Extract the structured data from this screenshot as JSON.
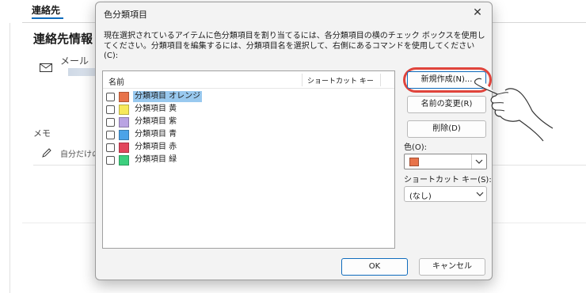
{
  "background": {
    "tab": "連絡先",
    "title": "連絡先情報",
    "mail_label": "メール",
    "memo_label": "メモ",
    "memo_placeholder": "自分だけの"
  },
  "dialog": {
    "title": "色分類項目",
    "description": "現在選択されているアイテムに色分類項目を割り当てるには、各分類項目の横のチェック ボックスを使用してください。分類項目を編集するには、分類項目名を選択して、右側にあるコマンドを使用してください(C):",
    "list": {
      "col_name": "名前",
      "col_shortcut": "ショートカット キー",
      "items": [
        {
          "label": "分類項目 オレンジ",
          "color": "#e8734a",
          "checked": false,
          "selected": true
        },
        {
          "label": "分類項目 黄",
          "color": "#f7e95b",
          "checked": false,
          "selected": false
        },
        {
          "label": "分類項目 紫",
          "color": "#b9a3e3",
          "checked": false,
          "selected": false
        },
        {
          "label": "分類項目 青",
          "color": "#4ba3e8",
          "checked": false,
          "selected": false
        },
        {
          "label": "分類項目 赤",
          "color": "#e2465c",
          "checked": false,
          "selected": false
        },
        {
          "label": "分類項目 緑",
          "color": "#3ccf7e",
          "checked": false,
          "selected": false
        }
      ]
    },
    "buttons": {
      "new": "新規作成(N)...",
      "rename": "名前の変更(R)",
      "delete": "削除(D)",
      "ok": "OK",
      "cancel": "キャンセル"
    },
    "color_label": "色(O):",
    "color_value": "#e8734a",
    "shortcut_label": "ショートカット キー(S):",
    "shortcut_value": "(なし)"
  },
  "colors": {
    "accent": "#0f6cbd",
    "highlight": "#e0443c",
    "selection": "#99c9ef"
  },
  "icons": [
    "mail-icon",
    "pencil-icon",
    "close-icon",
    "chevron-down-icon",
    "pointing-hand-icon"
  ]
}
